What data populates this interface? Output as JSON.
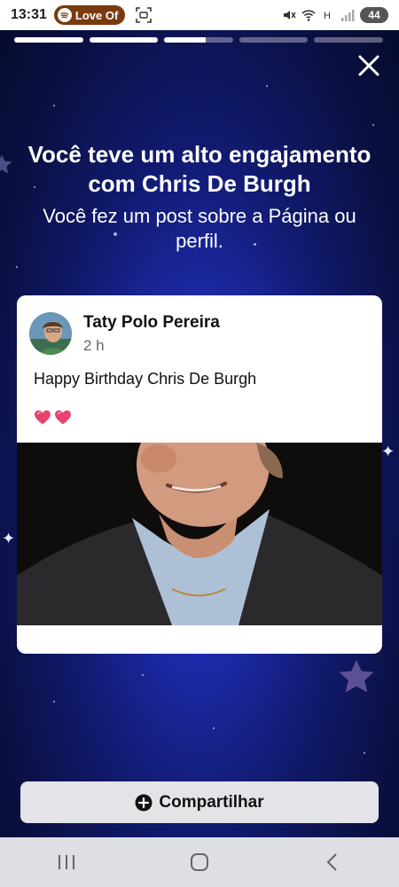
{
  "status_bar": {
    "time": "13:31",
    "media_label": "Love Of",
    "battery": "44"
  },
  "story": {
    "segments": [
      1,
      1,
      0.6,
      0,
      0
    ],
    "headline": "Você teve um alto engajamento com Chris De Burgh",
    "subline": "Você fez um post sobre a Página ou perfil."
  },
  "post": {
    "author": "Taty Polo Pereira",
    "time": "2 h",
    "text": "Happy Birthday Chris De Burgh",
    "reaction_icons": [
      "heart-icon",
      "heart-icon"
    ]
  },
  "actions": {
    "share_label": "Compartilhar"
  },
  "colors": {
    "background": "#1d2aa8",
    "card": "#ffffff",
    "share_button": "#e3e4e8",
    "media_pill": "#7a3a10",
    "heart": "#e8446e"
  },
  "icons": {
    "close": "close-icon",
    "share": "plus-circle-icon",
    "nav": [
      "recent-apps-icon",
      "home-icon",
      "back-icon"
    ]
  }
}
